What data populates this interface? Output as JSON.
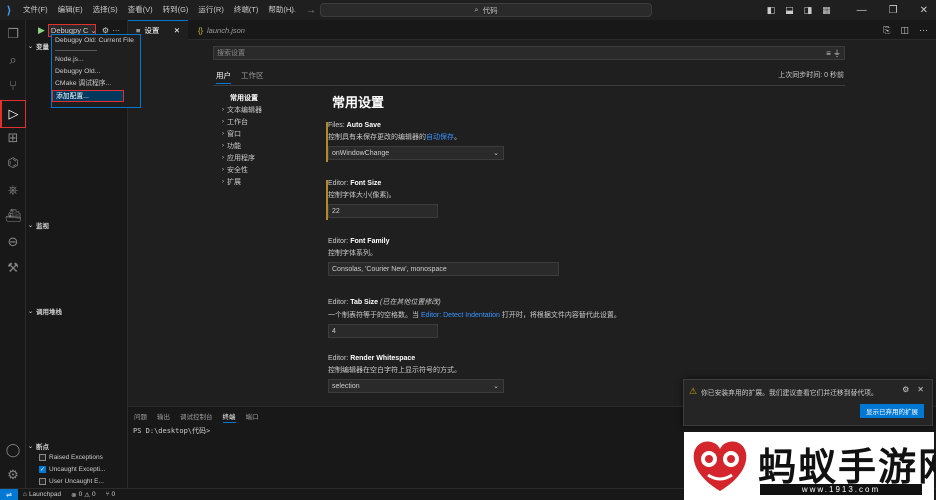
{
  "titlebar": {
    "menu": [
      "文件(F)",
      "编辑(E)",
      "选择(S)",
      "查看(V)",
      "转到(G)",
      "运行(R)",
      "终端(T)",
      "帮助(H)"
    ],
    "search_text": "代码",
    "search_icon": "search-icon"
  },
  "run_view": {
    "config_select": "Debugpy C",
    "sections": {
      "variables": "变量",
      "watch": "监视",
      "callstack": "调用堆栈",
      "breakpoints": "断点"
    },
    "breakpoints": [
      {
        "label": "Raised Exceptions",
        "checked": false
      },
      {
        "label": "Uncaught Excepti...",
        "checked": true
      },
      {
        "label": "User Uncaught E...",
        "checked": false
      }
    ]
  },
  "dropdown": {
    "items": [
      "Debugpy Old: Current File",
      "Node.js...",
      "Debugpy Old...",
      "CMake 调试程序...",
      "添加配置..."
    ]
  },
  "tabs": [
    {
      "label": "设置",
      "icon": "settings-file-icon"
    },
    {
      "label": "launch.json",
      "icon": "json-icon"
    }
  ],
  "settings": {
    "search_placeholder": "搜索设置",
    "scope_tabs": [
      "用户",
      "工作区"
    ],
    "sync_text": "上次同步时间: 0 秒前",
    "toc": [
      {
        "label": "常用设置",
        "expandable": false
      },
      {
        "label": "文本编辑器",
        "expandable": true
      },
      {
        "label": "工作台",
        "expandable": true
      },
      {
        "label": "窗口",
        "expandable": true
      },
      {
        "label": "功能",
        "expandable": true
      },
      {
        "label": "应用程序",
        "expandable": true
      },
      {
        "label": "安全性",
        "expandable": true
      },
      {
        "label": "扩展",
        "expandable": true
      }
    ],
    "heading": "常用设置",
    "items": [
      {
        "prefix": "Files: ",
        "name": "Auto Save",
        "note": "",
        "desc": "控制具有未保存更改的编辑器的",
        "link": "自动保存",
        "desc_after": "。",
        "value": "onWindowChange",
        "control": "select"
      },
      {
        "prefix": "Editor: ",
        "name": "Font Size",
        "note": "",
        "desc": "控制字体大小(像素)。",
        "link": "",
        "desc_after": "",
        "value": "22",
        "control": "input"
      },
      {
        "prefix": "Editor: ",
        "name": "Font Family",
        "note": "",
        "desc": "控制字体系列。",
        "link": "",
        "desc_after": "",
        "value": "Consolas, 'Courier New', monospace",
        "control": "input"
      },
      {
        "prefix": "Editor: ",
        "name": "Tab Size",
        "note": "(已在其他位置修改)",
        "desc": "一个制表符等于的空格数。当 ",
        "link": "Editor: Detect Indentation",
        "desc_after": " 打开时，将根据文件内容替代此设置。",
        "value": "4",
        "control": "input"
      },
      {
        "prefix": "Editor: ",
        "name": "Render Whitespace",
        "note": "",
        "desc": "控制编辑器在空白字符上显示符号的方式。",
        "link": "",
        "desc_after": "",
        "value": "selection",
        "control": "select"
      }
    ]
  },
  "panel": {
    "tabs": [
      "问题",
      "输出",
      "调试控制台",
      "终端",
      "端口"
    ],
    "active_tab": "终端",
    "terminal_line": "PS D:\\desktop\\代码>"
  },
  "notification": {
    "text": "你已安装弃用的扩展。我们建议查看它们并迁移到替代项。",
    "button": "显示已弃用的扩展"
  },
  "watermark": {
    "text": "蚂蚁手游网",
    "url": "www.1913.com"
  },
  "statusbar": {
    "launch": "Launchpad",
    "errors": "0",
    "warnings": "0",
    "ports": "0"
  },
  "colors": {
    "accent": "#0078d4",
    "highlight_border": "#e0312d",
    "modified": "#b38a25",
    "warning": "#cca700",
    "link": "#3794ff"
  }
}
